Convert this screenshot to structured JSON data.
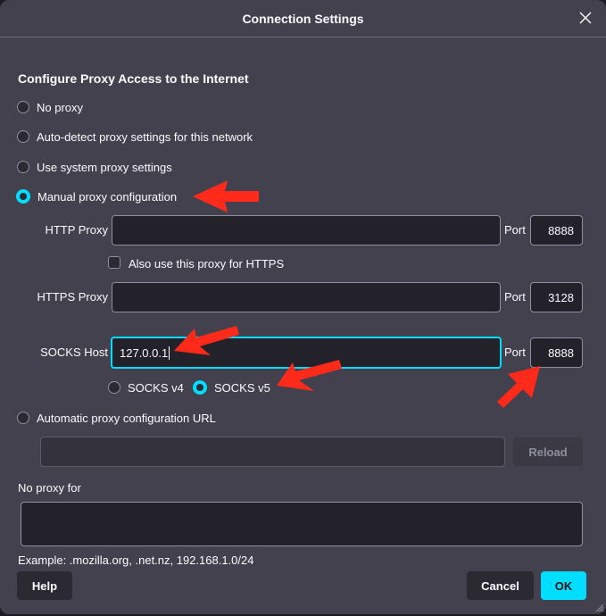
{
  "dialog": {
    "title": "Connection Settings",
    "close_icon": "close-icon"
  },
  "section": {
    "heading": "Configure Proxy Access to the Internet"
  },
  "proxy_modes": [
    {
      "label": "No proxy",
      "checked": false
    },
    {
      "label": "Auto-detect proxy settings for this network",
      "checked": false
    },
    {
      "label": "Use system proxy settings",
      "checked": false
    },
    {
      "label": "Manual proxy configuration",
      "checked": true
    },
    {
      "label": "Automatic proxy configuration URL",
      "checked": false
    }
  ],
  "manual": {
    "http": {
      "label": "HTTP Proxy",
      "value": "",
      "port_label": "Port",
      "port": "8888"
    },
    "also_https": {
      "label": "Also use this proxy for HTTPS",
      "checked": false
    },
    "https": {
      "label": "HTTPS Proxy",
      "value": "",
      "port_label": "Port",
      "port": "3128"
    },
    "socks": {
      "label": "SOCKS Host",
      "value": "127.0.0.1",
      "port_label": "Port",
      "port": "8888"
    },
    "socks_versions": [
      {
        "label": "SOCKS v4",
        "checked": false
      },
      {
        "label": "SOCKS v5",
        "checked": true
      }
    ]
  },
  "auto_url": {
    "value": "",
    "reload_label": "Reload"
  },
  "no_proxy": {
    "label": "No proxy for",
    "value": "",
    "example": "Example: .mozilla.org, .net.nz, 192.168.1.0/24"
  },
  "buttons": {
    "help": "Help",
    "cancel": "Cancel",
    "ok": "OK"
  },
  "colors": {
    "accent": "#00ddff",
    "dialog_bg": "#42414d",
    "input_bg": "#23222b",
    "annotation_arrow": "#ff2a1a"
  }
}
